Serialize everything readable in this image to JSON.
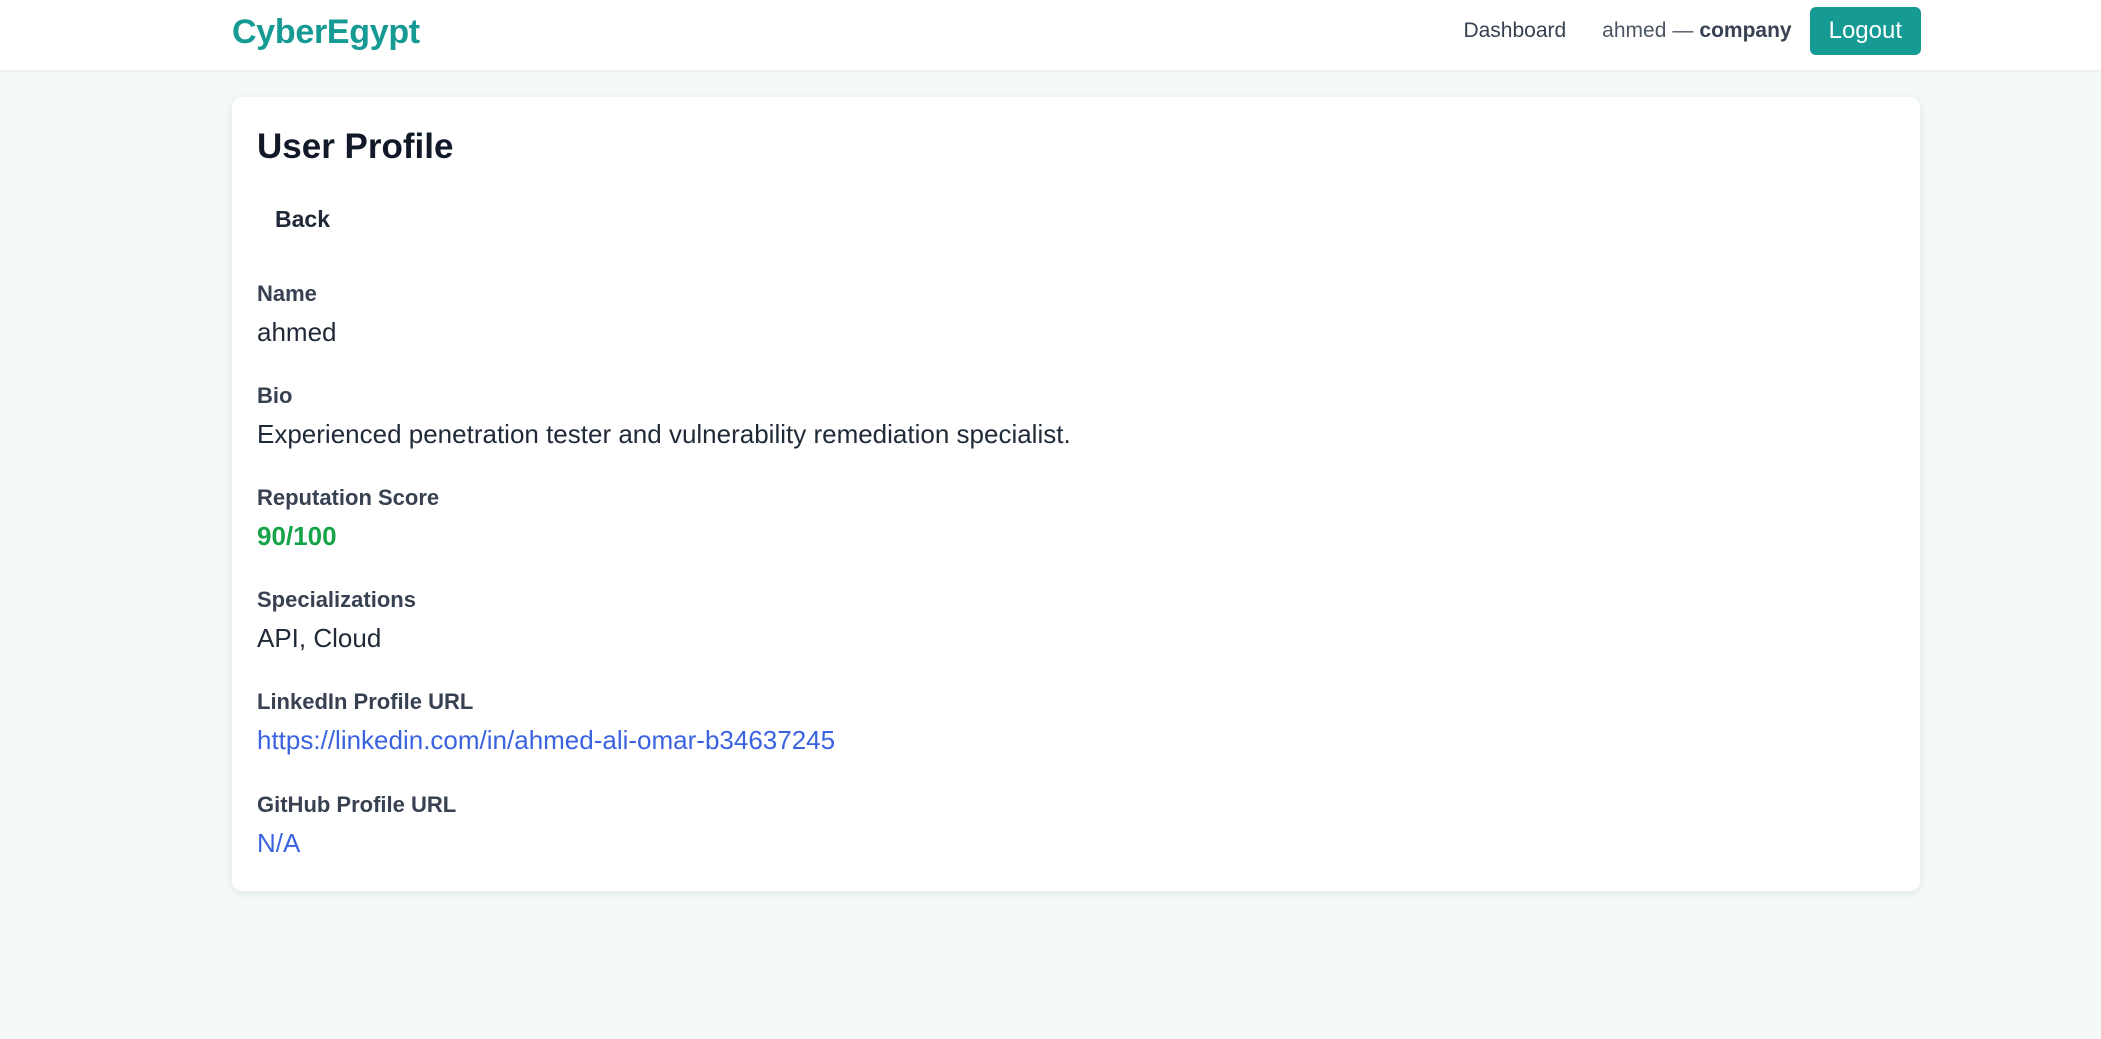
{
  "header": {
    "brand": "CyberEgypt",
    "nav_dashboard": "Dashboard",
    "user_name": "ahmed",
    "user_separator": "—",
    "user_role": "company",
    "logout_label": "Logout"
  },
  "profile": {
    "title": "User Profile",
    "back_label": "Back",
    "fields": {
      "name": {
        "label": "Name",
        "value": "ahmed"
      },
      "bio": {
        "label": "Bio",
        "value": "Experienced penetration tester and vulnerability remediation specialist."
      },
      "reputation": {
        "label": "Reputation Score",
        "value": "90/100"
      },
      "specializations": {
        "label": "Specializations",
        "value": "API, Cloud"
      },
      "linkedin": {
        "label": "LinkedIn Profile URL",
        "value": "https://linkedin.com/in/ahmed-ali-omar-b34637245"
      },
      "github": {
        "label": "GitHub Profile URL",
        "value": "N/A"
      }
    }
  },
  "colors": {
    "brand": "#159a94",
    "score": "#16a34a",
    "link": "#3b63e0",
    "background": "#f3f8f8"
  }
}
